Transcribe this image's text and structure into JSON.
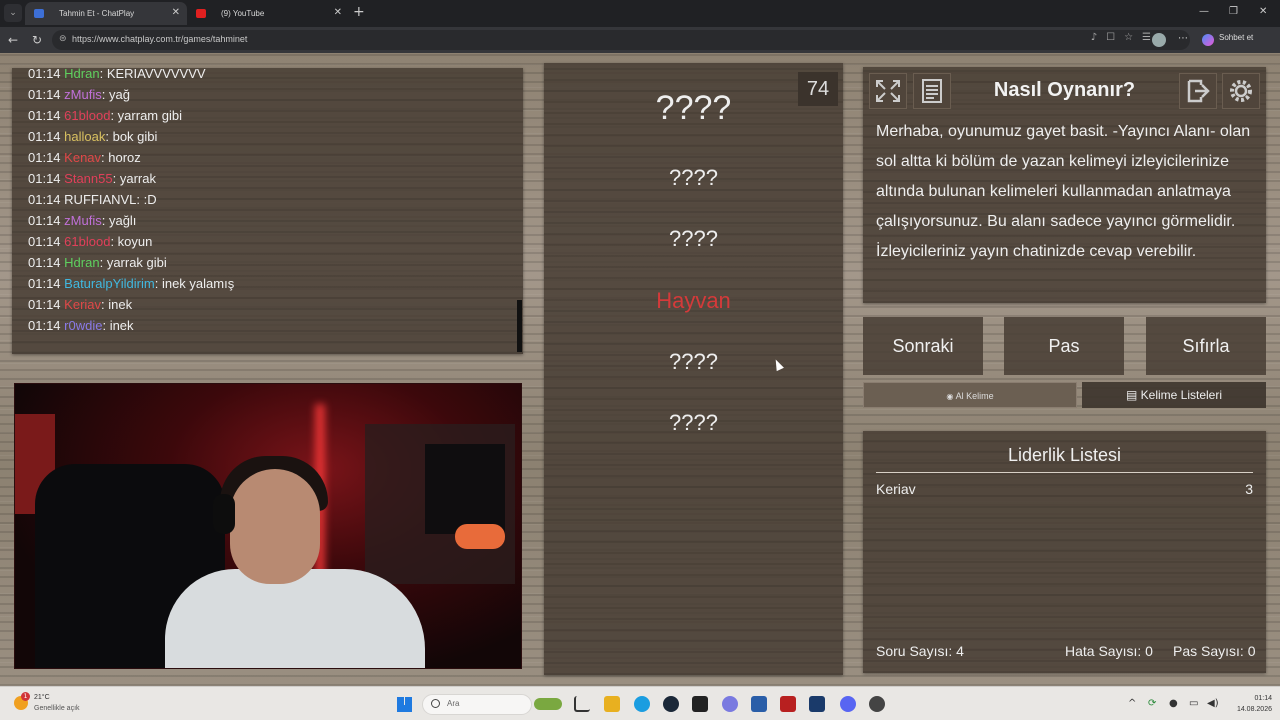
{
  "browser": {
    "tabs": [
      {
        "title": "Tahmin Et - ChatPlay",
        "fav_color": "#3d6fd6",
        "active": true
      },
      {
        "title": "(9) YouTube",
        "fav_color": "#e02020",
        "active": false
      }
    ],
    "url": "https://www.chatplay.com.tr/games/tahminet",
    "copilot_label": "Sohbet et"
  },
  "chat": {
    "messages": [
      {
        "time": "01:14",
        "user": "Hdran",
        "text": ": KERIAVVVVVVV",
        "color": "#5fd05f"
      },
      {
        "time": "01:14",
        "user": "zMufis",
        "text": ": yağ",
        "color": "#c070d8"
      },
      {
        "time": "01:14",
        "user": "61blood",
        "text": ": yarram gibi",
        "color": "#e0405a"
      },
      {
        "time": "01:14",
        "user": "halloak",
        "text": ": bok gibi",
        "color": "#d8c060"
      },
      {
        "time": "01:14",
        "user": "Kenav",
        "text": ": horoz",
        "color": "#e04848"
      },
      {
        "time": "01:14",
        "user": "Stann55",
        "text": ": yarrak",
        "color": "#e0405a"
      },
      {
        "time": "01:14",
        "user": "RUFFIANVL",
        "text": ": :D",
        "color": "#eeeeee"
      },
      {
        "time": "01:14",
        "user": "zMufis",
        "text": ": yağlı",
        "color": "#c070d8"
      },
      {
        "time": "01:14",
        "user": "61blood",
        "text": ": koyun",
        "color": "#e0405a"
      },
      {
        "time": "01:14",
        "user": "Hdran",
        "text": ": yarrak gibi",
        "color": "#5fd05f"
      },
      {
        "time": "01:14",
        "user": "BaturalpYildirim",
        "text": ": inek yalamış",
        "color": "#40b8e0"
      },
      {
        "time": "01:14",
        "user": "Keriav",
        "text": ": inek",
        "color": "#e04848"
      },
      {
        "time": "01:14",
        "user": "r0wdie",
        "text": ": inek",
        "color": "#8a7ae8"
      }
    ]
  },
  "words": {
    "counter": "74",
    "items": [
      "????",
      "????",
      "????",
      "Hayvan",
      "????",
      "????"
    ],
    "highlight_color": "#d43a3a"
  },
  "help": {
    "title": "Nasıl Oynanır?",
    "text": "Merhaba, oyunumuz gayet basit. -Yayıncı Alanı- olan sol altta ki bölüm de yazan kelimeyi izleyicilerinize altında bulunan kelimeleri kullanmadan anlatmaya çalışıyorsunuz. Bu alanı sadece yayıncı görmelidir. İzleyicileriniz yayın chatinizde cevap verebilir."
  },
  "actions": {
    "next": "Sonraki",
    "pass": "Pas",
    "reset": "Sıfırla",
    "get_word": "Al Kelime",
    "word_lists": "Kelime Listeleri"
  },
  "leaderboard": {
    "title": "Liderlik Listesi",
    "entries": [
      {
        "name": "Keriav",
        "score": "3"
      }
    ],
    "question_count": "Soru Sayısı: 4",
    "error_count": "Hata Sayısı: 0",
    "pass_count": "Pas Sayısı: 0"
  },
  "taskbar": {
    "weather_temp": "21°C",
    "weather_desc": "Genellikle açık",
    "weather_badge": "1",
    "search_placeholder": "Ara",
    "time": "01:14",
    "date": "14.08.2026"
  }
}
